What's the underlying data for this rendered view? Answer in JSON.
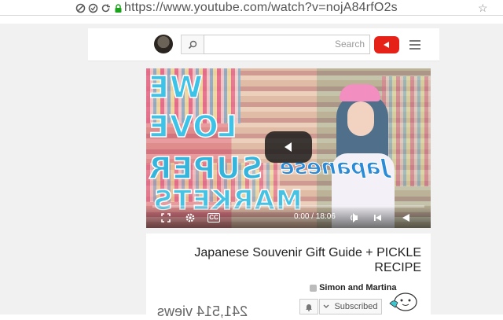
{
  "browser": {
    "url": "https://www.youtube.com/watch?v=nojA84rfO2s",
    "icons": [
      "blocked-icon",
      "security-icon",
      "reload-icon",
      "lock-icon"
    ],
    "accent_secure": "#1aa31a"
  },
  "header": {
    "search_placeholder": "Search",
    "logo_color": "#e62117"
  },
  "video": {
    "overlay_lines": [
      "WE",
      "LOVE",
      "SUPER",
      "MARKETS"
    ],
    "overlay_script": "Japanese",
    "time_display": "0:00 / 18:06",
    "cc_label": "CC"
  },
  "info": {
    "title": "Japanese Souvenir Gift Guide + PICKLE RECIPE",
    "channel": "Simon and Martina",
    "subscribe_label": "Subscribed",
    "views": "241,514 views"
  }
}
